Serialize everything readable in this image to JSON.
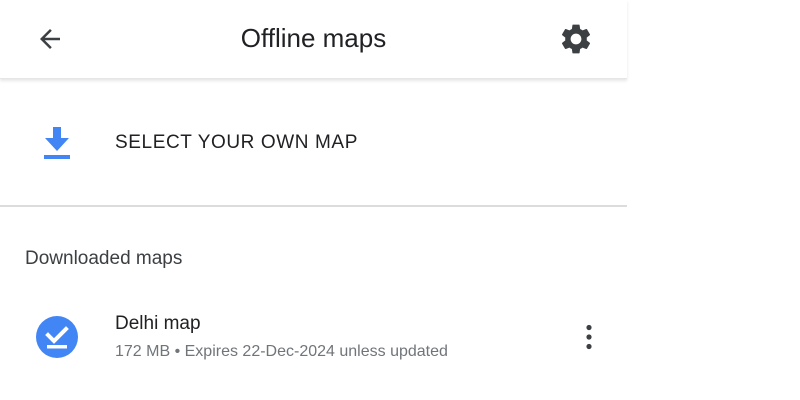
{
  "appbar": {
    "title": "Offline maps",
    "back_icon": "arrow-back-icon",
    "settings_icon": "gear-icon"
  },
  "select_map": {
    "label": "SELECT YOUR OWN MAP",
    "icon": "download-icon",
    "icon_color": "#4285f4"
  },
  "downloaded": {
    "header": "Downloaded maps",
    "items": [
      {
        "name": "Delhi map",
        "meta": "172 MB • Expires 22-Dec-2024 unless updated",
        "icon": "check-circle-icon",
        "icon_color": "#4285f4",
        "menu_icon": "more-vert-icon"
      }
    ]
  }
}
